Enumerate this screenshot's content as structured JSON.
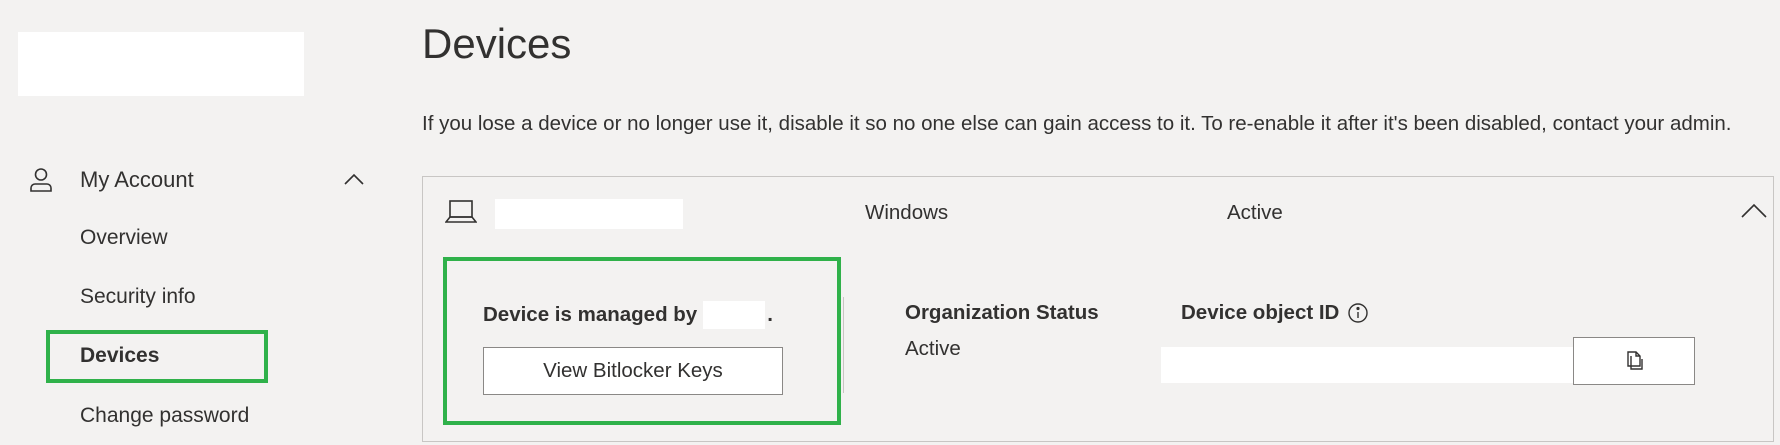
{
  "sidebar": {
    "section_label": "My Account",
    "items": [
      {
        "label": "Overview"
      },
      {
        "label": "Security info"
      },
      {
        "label": "Devices"
      },
      {
        "label": "Change password"
      }
    ]
  },
  "main": {
    "title": "Devices",
    "description": "If you lose a device or no longer use it, disable it so no one else can gain access to it. To re-enable it after it's been disabled, contact your admin.",
    "device": {
      "os": "Windows",
      "status": "Active",
      "managed_by_prefix": "Device is managed by",
      "managed_by_suffix": ".",
      "bitlocker_button": "View Bitlocker Keys",
      "org_status_label": "Organization Status",
      "org_status_value": "Active",
      "object_id_label": "Device object ID"
    }
  },
  "colors": {
    "highlight": "#2fb14a",
    "background": "#f3f2f1",
    "text": "#323130"
  },
  "icons": {
    "person": "person-icon",
    "chevron_up": "chevron-up-icon",
    "laptop": "laptop-icon",
    "info": "info-icon",
    "copy": "copy-icon"
  }
}
